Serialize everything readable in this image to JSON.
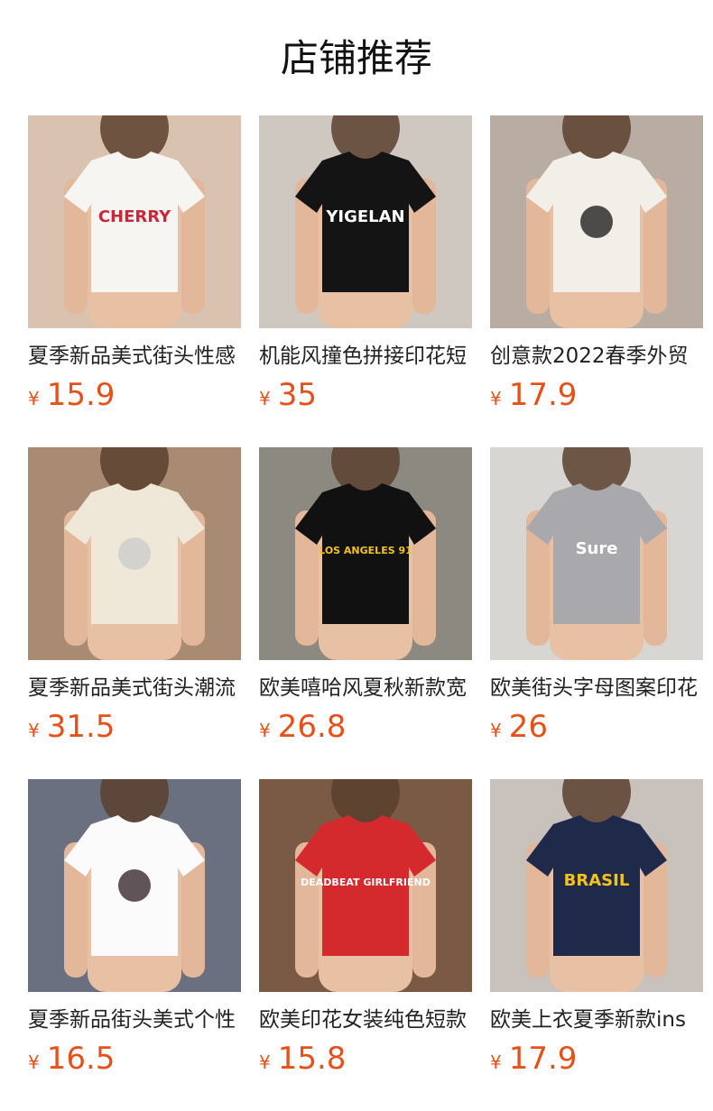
{
  "header": {
    "title": "店铺推荐"
  },
  "products": [
    {
      "name": "夏季新品美式街头性感",
      "currency": "¥",
      "price": "15.9",
      "image": {
        "bg": "#d9c3b0",
        "shirt": "#f7f5f2",
        "print_text": "CHERRY",
        "print_color": "#c8283a",
        "icon": "cherry-print-icon"
      }
    },
    {
      "name": "机能风撞色拼接印花短",
      "currency": "¥",
      "price": "35",
      "image": {
        "bg": "#cfc8c0",
        "shirt": "#141414",
        "print_text": "YIGELAN",
        "print_color": "#ffffff",
        "icon": "star-print-icon"
      }
    },
    {
      "name": "创意款2022春季外贸",
      "currency": "¥",
      "price": "17.9",
      "image": {
        "bg": "#b9aca2",
        "shirt": "#f2efe9",
        "print_text": "",
        "print_color": "#222222",
        "icon": "sketch-print-icon"
      }
    },
    {
      "name": "夏季新品美式街头潮流",
      "currency": "¥",
      "price": "31.5",
      "image": {
        "bg": "#a88b72",
        "shirt": "#efe8d8",
        "print_text": "",
        "print_color": "#cccccc",
        "icon": "dress-icon"
      }
    },
    {
      "name": "欧美嘻哈风夏秋新款宽",
      "currency": "¥",
      "price": "26.8",
      "image": {
        "bg": "#8c8a80",
        "shirt": "#111111",
        "print_text": "LOS ANGELES 91",
        "print_color": "#f3c21b",
        "icon": "jersey-print-icon"
      }
    },
    {
      "name": "欧美街头字母图案印花",
      "currency": "¥",
      "price": "26",
      "image": {
        "bg": "#d8d6d2",
        "shirt": "#a9a9ad",
        "print_text": "Sure",
        "print_color": "#ffffff",
        "icon": "script-print-icon"
      }
    },
    {
      "name": "夏季新品街头美式个性",
      "currency": "¥",
      "price": "16.5",
      "image": {
        "bg": "#6a7080",
        "shirt": "#fbfbfb",
        "print_text": "",
        "print_color": "#3a2a30",
        "icon": "star-print-icon"
      }
    },
    {
      "name": "欧美印花女装纯色短款",
      "currency": "¥",
      "price": "15.8",
      "image": {
        "bg": "#7a5a44",
        "shirt": "#d42a2e",
        "print_text": "DEADBEAT GIRLFRIEND",
        "print_color": "#ffffff",
        "icon": "text-print-icon"
      }
    },
    {
      "name": "欧美上衣夏季新款ins",
      "currency": "¥",
      "price": "17.9",
      "image": {
        "bg": "#c9c2bc",
        "shirt": "#1f2a4a",
        "print_text": "BRASIL",
        "print_color": "#f3c21b",
        "icon": "flag-print-icon"
      }
    }
  ]
}
